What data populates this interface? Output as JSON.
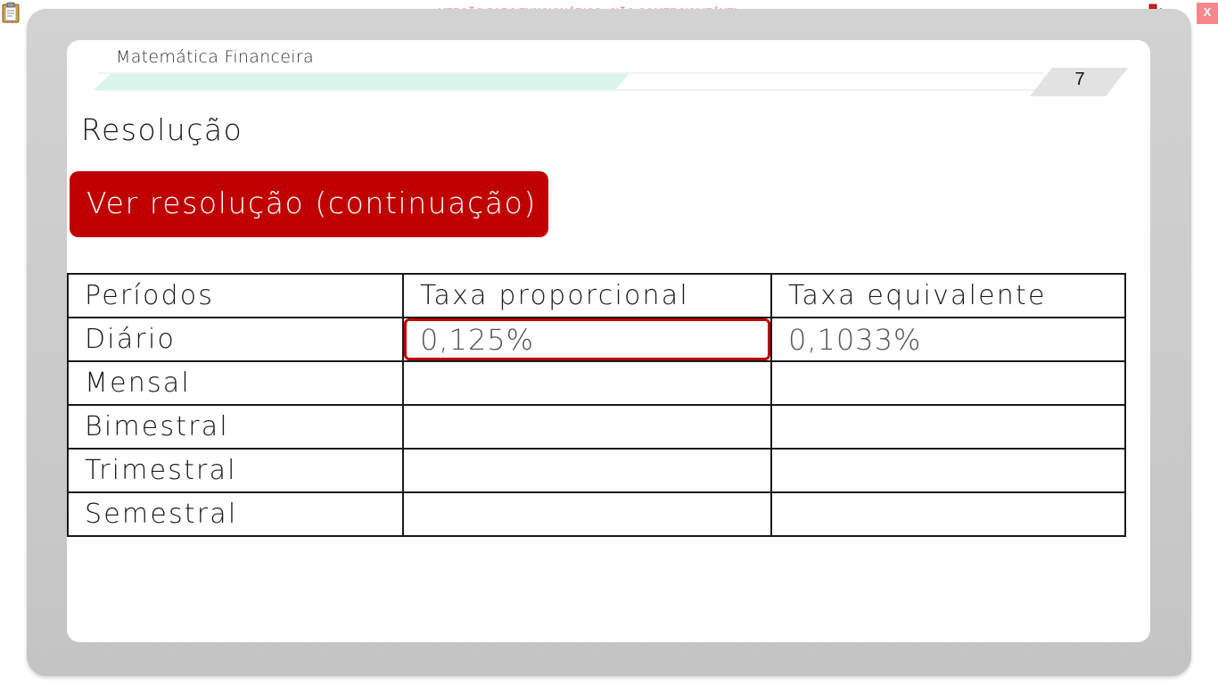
{
  "toolbar": {
    "watermark": "VERSÃO PARA FUNCIONÁRIOS - NÃO COMERCIALIZÁVEL",
    "close_label": "X",
    "left_icon": "clipboard-icon",
    "right_icon": "network-icon"
  },
  "slide": {
    "course": "Matemática Financeira",
    "page_number": "7",
    "title": "Resolução",
    "resolve_button": "Ver resolução (continuação)"
  },
  "table": {
    "headers": [
      "Períodos",
      "Taxa proporcional",
      "Taxa equivalente"
    ],
    "rows": [
      {
        "period": "Diário",
        "proportional": "0,125%",
        "equivalent": "0,1033%"
      },
      {
        "period": "Mensal",
        "proportional": "",
        "equivalent": ""
      },
      {
        "period": "Bimestral",
        "proportional": "",
        "equivalent": ""
      },
      {
        "period": "Trimestral",
        "proportional": "",
        "equivalent": ""
      },
      {
        "period": "Semestral",
        "proportional": "",
        "equivalent": ""
      }
    ],
    "highlighted_cell": "Diário / Taxa proporcional"
  },
  "colors": {
    "accent": "#c00000",
    "watermark": "#e8707a",
    "header_stripe": "#d9f5ec",
    "frame": "#c8c8c8"
  }
}
